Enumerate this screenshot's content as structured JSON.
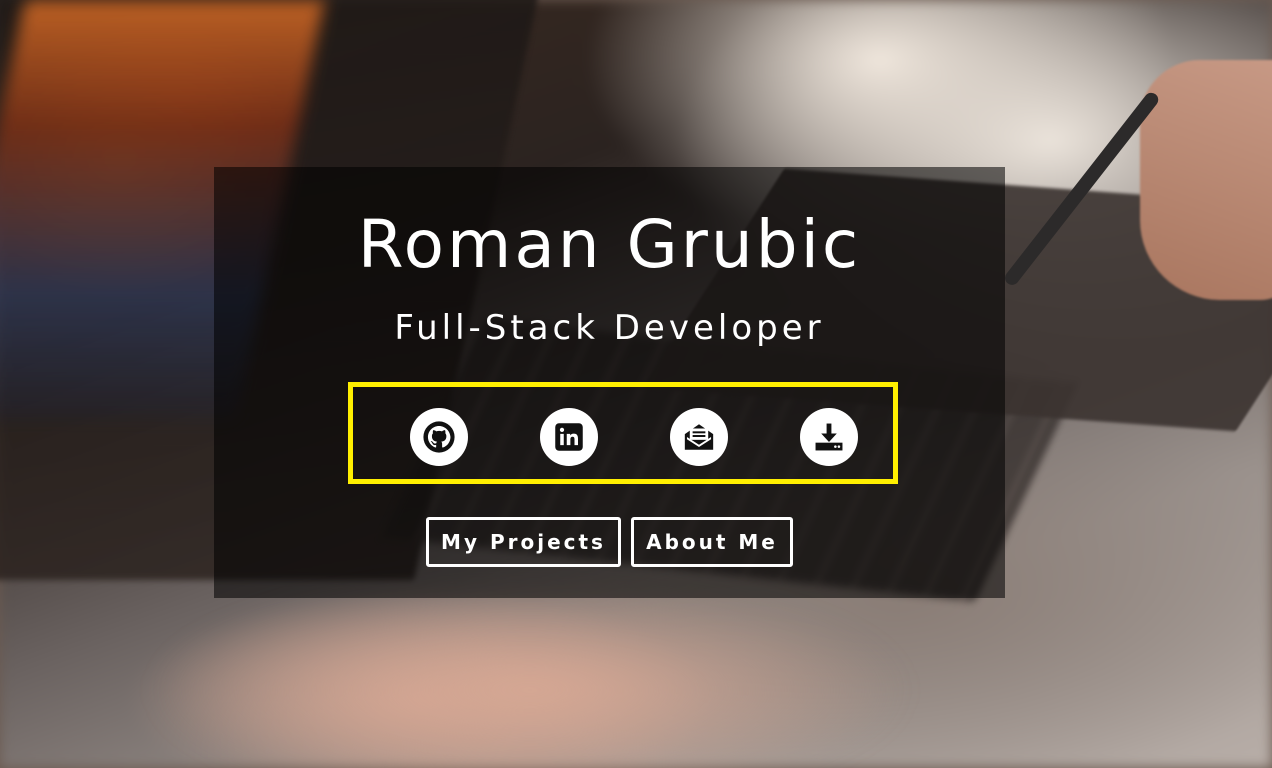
{
  "hero": {
    "name": "Roman Grubic",
    "role": "Full-Stack Developer",
    "highlight_color": "#ffef00"
  },
  "social_icons": [
    {
      "icon": "github-icon",
      "label": "GitHub"
    },
    {
      "icon": "linkedin-icon",
      "label": "LinkedIn"
    },
    {
      "icon": "email-icon",
      "label": "Email"
    },
    {
      "icon": "download-icon",
      "label": "Download"
    }
  ],
  "buttons": {
    "projects_label": "My Projects",
    "about_label": "About Me"
  }
}
